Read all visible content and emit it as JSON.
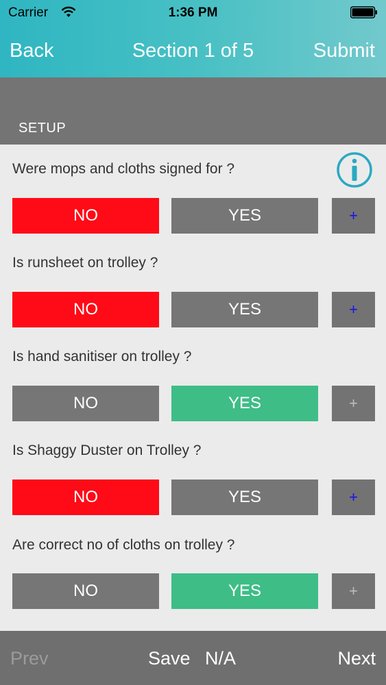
{
  "status_bar": {
    "carrier": "Carrier",
    "time": "1:36 PM",
    "wifi_icon": "wifi-icon",
    "battery_icon": "battery-icon"
  },
  "nav": {
    "back": "Back",
    "title": "Section 1 of 5",
    "submit": "Submit"
  },
  "section": {
    "label": "SETUP"
  },
  "info_icon": "info-circle-icon",
  "questions": [
    {
      "text": "Were mops and cloths signed for ?",
      "no": "NO",
      "yes": "YES",
      "plus": "+",
      "selected": "NO"
    },
    {
      "text": "Is runsheet on trolley ?",
      "no": "NO",
      "yes": "YES",
      "plus": "+",
      "selected": "NO"
    },
    {
      "text": "Is hand sanitiser on trolley ?",
      "no": "NO",
      "yes": "YES",
      "plus": "+",
      "selected": "YES"
    },
    {
      "text": "Is Shaggy Duster on Trolley ?",
      "no": "NO",
      "yes": "YES",
      "plus": "+",
      "selected": "NO"
    },
    {
      "text": "Are correct no of cloths on trolley ?",
      "no": "NO",
      "yes": "YES",
      "plus": "+",
      "selected": "YES"
    }
  ],
  "footer": {
    "prev": "Prev",
    "save": "Save",
    "na": "N/A",
    "next": "Next"
  },
  "colors": {
    "header_teal": "#2fb6c2",
    "no_selected": "#ff0a17",
    "yes_selected": "#3ebd87",
    "unselected": "#767676",
    "plus_active": "#1515e8"
  }
}
